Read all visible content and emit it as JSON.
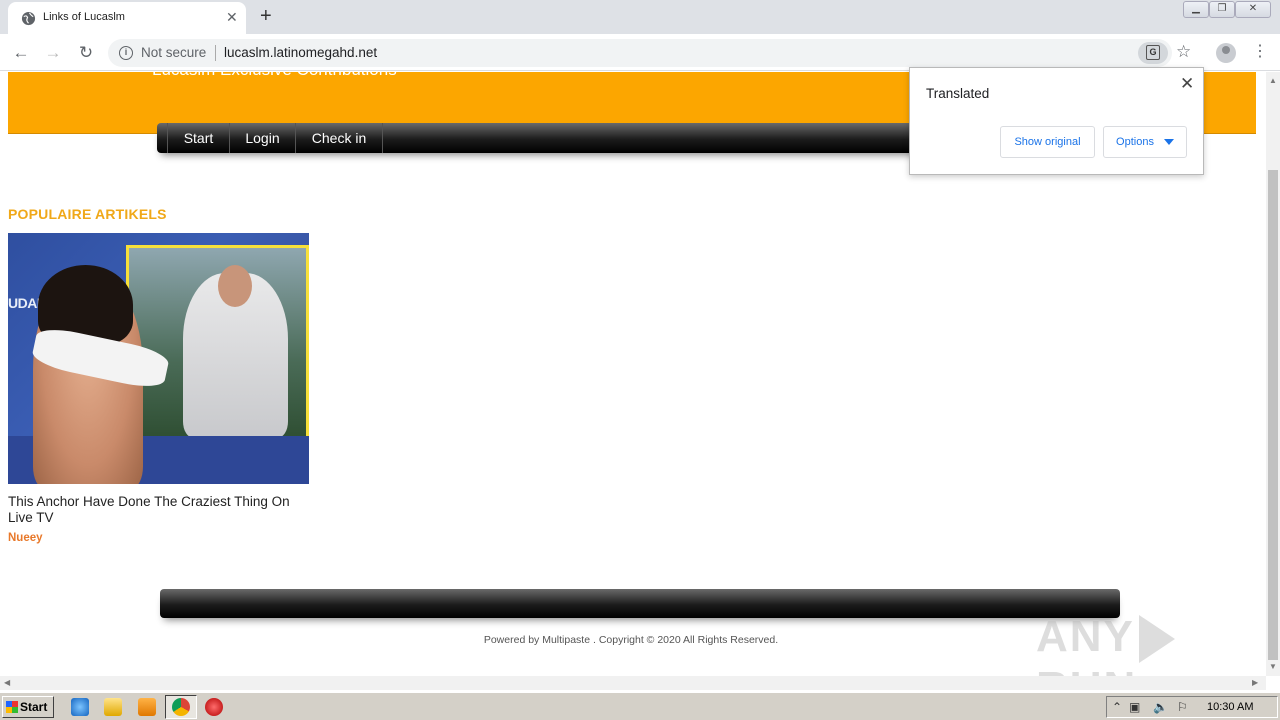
{
  "browser": {
    "tab_title": "Links of Lucaslm",
    "not_secure": "Not secure",
    "url": "lucaslm.latinomegahd.net"
  },
  "page": {
    "site_title": "Lucaslm Exclusive Contributions",
    "nav": [
      "Start",
      "Login",
      "Check in"
    ],
    "section_title": "POPULAIRE ARTIKELS",
    "thumbnail_text": "UDANDO OTI",
    "article_title": "This Anchor Have Done The Craziest Thing On Live TV",
    "article_author": "Nueey",
    "footer": "Powered by Multipaste . Copyright © 2020 All Rights Reserved."
  },
  "translate_popup": {
    "title": "Translated",
    "show_original": "Show original",
    "options": "Options"
  },
  "watermark": {
    "left": "ANY",
    "right": "RUN"
  },
  "taskbar": {
    "start": "Start",
    "time": "10:30 AM"
  },
  "colors": {
    "banner": "#fca600",
    "section_title": "#f0a818",
    "author": "#e8792b",
    "link_blue": "#1a73e8"
  }
}
